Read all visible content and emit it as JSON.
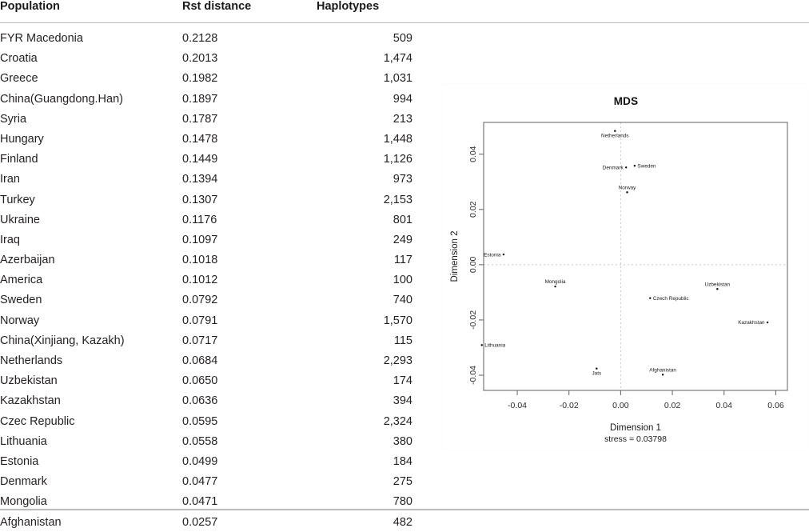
{
  "table": {
    "columns": [
      "Population",
      "Rst distance",
      "Haplotypes"
    ],
    "rows": [
      {
        "population": "FYR Macedonia",
        "rst": "0.2128",
        "haplotypes": "509"
      },
      {
        "population": "Croatia",
        "rst": "0.2013",
        "haplotypes": "1,474"
      },
      {
        "population": "Greece",
        "rst": "0.1982",
        "haplotypes": "1,031"
      },
      {
        "population": "China(Guangdong.Han)",
        "rst": "0.1897",
        "haplotypes": "994"
      },
      {
        "population": "Syria",
        "rst": "0.1787",
        "haplotypes": "213"
      },
      {
        "population": "Hungary",
        "rst": "0.1478",
        "haplotypes": "1,448"
      },
      {
        "population": "Finland",
        "rst": "0.1449",
        "haplotypes": "1,126"
      },
      {
        "population": "Iran",
        "rst": "0.1394",
        "haplotypes": "973"
      },
      {
        "population": "Turkey",
        "rst": "0.1307",
        "haplotypes": "2,153"
      },
      {
        "population": "Ukraine",
        "rst": "0.1176",
        "haplotypes": "801"
      },
      {
        "population": "Iraq",
        "rst": "0.1097",
        "haplotypes": "249"
      },
      {
        "population": "Azerbaijan",
        "rst": "0.1018",
        "haplotypes": "117"
      },
      {
        "population": "America",
        "rst": "0.1012",
        "haplotypes": "100"
      },
      {
        "population": "Sweden",
        "rst": "0.0792",
        "haplotypes": "740"
      },
      {
        "population": "Norway",
        "rst": "0.0791",
        "haplotypes": "1,570"
      },
      {
        "population": "China(Xinjiang, Kazakh)",
        "rst": "0.0717",
        "haplotypes": "115"
      },
      {
        "population": "Netherlands",
        "rst": "0.0684",
        "haplotypes": "2,293"
      },
      {
        "population": "Uzbekistan",
        "rst": "0.0650",
        "haplotypes": "174"
      },
      {
        "population": "Kazakhstan",
        "rst": "0.0636",
        "haplotypes": "394"
      },
      {
        "population": "Czec Republic",
        "rst": "0.0595",
        "haplotypes": "2,324"
      },
      {
        "population": "Lithuania",
        "rst": "0.0558",
        "haplotypes": "380"
      },
      {
        "population": "Estonia",
        "rst": "0.0499",
        "haplotypes": "184"
      },
      {
        "population": "Denmark",
        "rst": "0.0477",
        "haplotypes": "275"
      },
      {
        "population": "Mongolia",
        "rst": "0.0471",
        "haplotypes": "780"
      },
      {
        "population": "Afghanistan",
        "rst": "0.0257",
        "haplotypes": "482"
      }
    ]
  },
  "chart_data": {
    "type": "scatter",
    "title": "MDS",
    "xlabel": "Dimension 1",
    "ylabel": "Dimension 2",
    "subtitle": "stress = 0.03798",
    "xlim": [
      -0.053,
      0.0645
    ],
    "ylim": [
      -0.0455,
      0.0515
    ],
    "xticks": [
      -0.04,
      -0.02,
      0.0,
      0.02,
      0.04,
      0.06
    ],
    "xtick_labels": [
      "-0.04",
      "-0.02",
      "0.00",
      "0.02",
      "0.04",
      "0.06"
    ],
    "yticks": [
      -0.04,
      -0.02,
      0.0,
      0.02,
      0.04
    ],
    "ytick_labels": [
      "-0.04",
      "-0.02",
      "0.00",
      "0.02",
      "0.04"
    ],
    "grid": false,
    "reference_lines": {
      "x": 0.0,
      "y": 0.0,
      "style": "dotted",
      "color": "#c8c8c8"
    },
    "point_color": "#000000",
    "points": [
      {
        "label": "Netherlands",
        "x": -0.0022,
        "y": 0.0484,
        "label_pos": "below"
      },
      {
        "label": "Denmark",
        "x": 0.0021,
        "y": 0.0352,
        "label_pos": "left"
      },
      {
        "label": "Sweden",
        "x": 0.0054,
        "y": 0.0358,
        "label_pos": "right"
      },
      {
        "label": "Norway",
        "x": 0.0025,
        "y": 0.0262,
        "label_pos": "above"
      },
      {
        "label": "Estonia",
        "x": -0.0453,
        "y": 0.0037,
        "label_pos": "left"
      },
      {
        "label": "Mongolia",
        "x": -0.0253,
        "y": -0.0079,
        "label_pos": "above"
      },
      {
        "label": "Uzbekistan",
        "x": 0.0374,
        "y": -0.0088,
        "label_pos": "above"
      },
      {
        "label": "Czech Republic",
        "x": 0.0114,
        "y": -0.0121,
        "label_pos": "right"
      },
      {
        "label": "Kazakhstan",
        "x": 0.0568,
        "y": -0.0209,
        "label_pos": "left"
      },
      {
        "label": "Lithuania",
        "x": -0.0537,
        "y": -0.0291,
        "label_pos": "right"
      },
      {
        "label": "Jats",
        "x": -0.0093,
        "y": -0.0376,
        "label_pos": "below"
      },
      {
        "label": "Afghanistan",
        "x": 0.0163,
        "y": -0.0398,
        "label_pos": "above"
      }
    ]
  }
}
